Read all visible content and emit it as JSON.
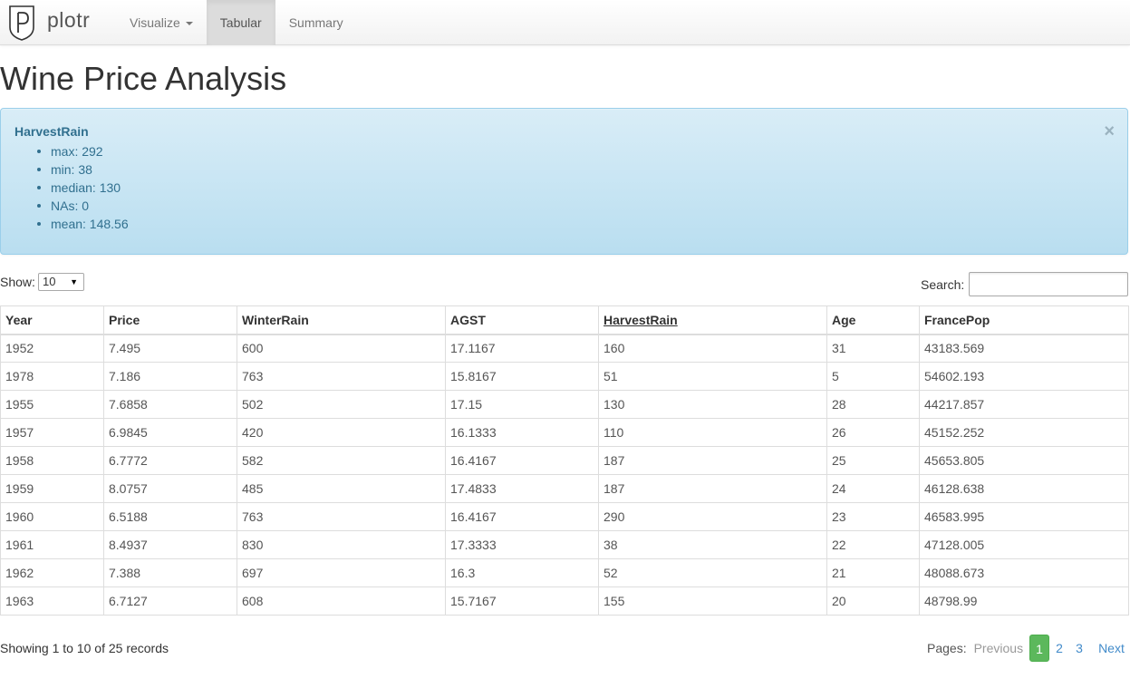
{
  "navbar": {
    "brand": "plotr",
    "items": [
      {
        "label": "Visualize"
      },
      {
        "label": "Tabular"
      },
      {
        "label": "Summary"
      }
    ]
  },
  "page_title": "Wine Price Analysis",
  "alert": {
    "title": "HarvestRain",
    "stats": [
      "max: 292",
      "min: 38",
      "median: 130",
      "NAs: 0",
      "mean: 148.56"
    ],
    "close": "×"
  },
  "controls": {
    "show_label": "Show:",
    "show_value": "10",
    "search_label": "Search:",
    "search_value": ""
  },
  "table": {
    "columns": [
      "Year",
      "Price",
      "WinterRain",
      "AGST",
      "HarvestRain",
      "Age",
      "FrancePop"
    ],
    "sorted_column": "HarvestRain",
    "rows": [
      [
        "1952",
        "7.495",
        "600",
        "17.1167",
        "160",
        "31",
        "43183.569"
      ],
      [
        "1978",
        "7.186",
        "763",
        "15.8167",
        "51",
        "5",
        "54602.193"
      ],
      [
        "1955",
        "7.6858",
        "502",
        "17.15",
        "130",
        "28",
        "44217.857"
      ],
      [
        "1957",
        "6.9845",
        "420",
        "16.1333",
        "110",
        "26",
        "45152.252"
      ],
      [
        "1958",
        "6.7772",
        "582",
        "16.4167",
        "187",
        "25",
        "45653.805"
      ],
      [
        "1959",
        "8.0757",
        "485",
        "17.4833",
        "187",
        "24",
        "46128.638"
      ],
      [
        "1960",
        "6.5188",
        "763",
        "16.4167",
        "290",
        "23",
        "46583.995"
      ],
      [
        "1961",
        "8.4937",
        "830",
        "17.3333",
        "38",
        "22",
        "47128.005"
      ],
      [
        "1962",
        "7.388",
        "697",
        "16.3",
        "52",
        "21",
        "48088.673"
      ],
      [
        "1963",
        "6.7127",
        "608",
        "15.7167",
        "155",
        "20",
        "48798.99"
      ]
    ]
  },
  "footer": {
    "info": "Showing 1 to 10 of 25 records",
    "pages_label": "Pages:",
    "previous": "Previous",
    "pages": [
      "1",
      "2",
      "3"
    ],
    "current_page": "1",
    "next": "Next"
  },
  "colors": {
    "accent": "#428bca",
    "alert_bg": "#d9edf7",
    "alert_text": "#31708f",
    "current_page": "#5cb85c"
  }
}
